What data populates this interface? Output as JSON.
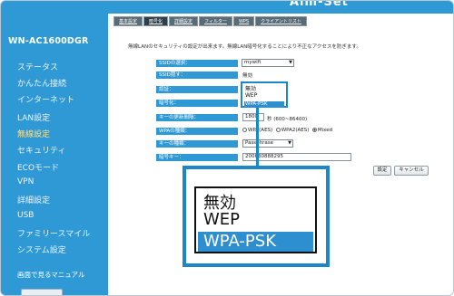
{
  "router": {
    "name": "WN-AC1600DGR"
  },
  "header": {
    "logo_text": "Aim-Set"
  },
  "tabs": [
    {
      "label": "基本設定"
    },
    {
      "label": "暗号化"
    },
    {
      "label": "詳細設定"
    },
    {
      "label": "フィルター"
    },
    {
      "label": "WPS"
    },
    {
      "label": "クライアントリスト"
    }
  ],
  "sidebar": {
    "items": [
      {
        "label": "ステータス"
      },
      {
        "label": "かんたん接続"
      },
      {
        "label": "インターネット"
      },
      {
        "label": "LAN設定"
      },
      {
        "label": "無線設定"
      },
      {
        "label": "セキュリティ"
      },
      {
        "label": "ECOモード"
      },
      {
        "label": "VPN"
      },
      {
        "label": "詳細設定"
      },
      {
        "label": "USB"
      },
      {
        "label": "ファミリースマイル"
      },
      {
        "label": "システム設定"
      }
    ],
    "manual_label": "画面で見るマニュアル"
  },
  "notice": "無線LANのセキュリティの設定が出来ます。無線LAN暗号化することにより不正なアクセスを防ぎます。",
  "form": {
    "ssid_select_label": "SSIDの選択：",
    "ssid_select_value": "mywifi",
    "ssid_stealth_label": "SSID隠す：",
    "ssid_stealth_value": "無効",
    "mode_label": "認証：",
    "encryption_label": "暗号化：",
    "key_interval_label": "キーの更新間隔：",
    "key_interval_value": "1800",
    "key_interval_unit": "秒 (600~86400)",
    "wpa_type_label": "WPAの種類：",
    "wpa_options": [
      {
        "label": "WPA(AES)",
        "selected": false
      },
      {
        "label": "WPA2(AES)",
        "selected": false
      },
      {
        "label": "Mixed",
        "selected": true
      }
    ],
    "key_type_label": "キーの種類：",
    "key_type_value": "Passphrase",
    "key_label": "暗号キー：",
    "key_value": "200630888295",
    "save_button": "設定",
    "cancel_button": "キャンセル"
  },
  "dropdown": {
    "options": [
      "無効",
      "WEP",
      "WPA-PSK"
    ],
    "selected": "WPA-PSK"
  },
  "colors": {
    "sidebar": "#2f99d6",
    "active_menu": "#ffe08a",
    "highlight": "#1c86c6"
  }
}
